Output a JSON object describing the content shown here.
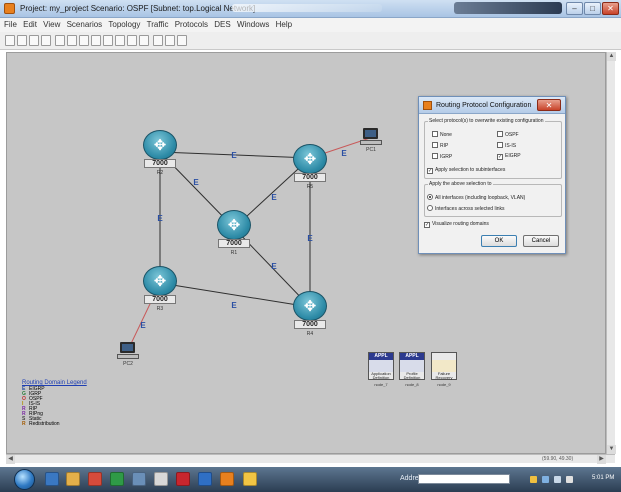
{
  "window": {
    "title": "Project: my_project Scenario: OSPF  [Subnet: top.Logical Network]",
    "min": "–",
    "max": "□",
    "close": "✕"
  },
  "menu": [
    "File",
    "Edit",
    "View",
    "Scenarios",
    "Topology",
    "Traffic",
    "Protocols",
    "DES",
    "Windows",
    "Help"
  ],
  "toolbar_icons": [
    "new-icon",
    "open-icon",
    "save-icon",
    "print-icon",
    "cut-icon",
    "object-palette-icon",
    "link-icon",
    "failure-icon",
    "zoom-in-icon",
    "zoom-out-icon",
    "configure-icon",
    "statistics-icon",
    "results-icon",
    "web-report-icon",
    "hide-icon"
  ],
  "network": {
    "link_label": "E",
    "router_model": "7000",
    "routers": [
      {
        "id": "R2",
        "name": "R2"
      },
      {
        "id": "R1",
        "name": "R1"
      },
      {
        "id": "R4_top",
        "name": "R5"
      },
      {
        "id": "R3",
        "name": "R3"
      },
      {
        "id": "R4",
        "name": "R4"
      }
    ],
    "pcs": [
      {
        "id": "PC1",
        "name": "PC1"
      },
      {
        "id": "PC2",
        "name": "PC2"
      }
    ],
    "nodes": [
      {
        "hdr": "APPL",
        "lbl1": "Application",
        "lbl2": "Definition",
        "name": "node_7"
      },
      {
        "hdr": "APPL",
        "lbl1": "Profile",
        "lbl2": "Definition",
        "name": "node_8"
      },
      {
        "hdr": "",
        "lbl1": "Failure",
        "lbl2": "Recovery",
        "name": "node_9"
      }
    ]
  },
  "legend": {
    "title": "Routing Domain Legend",
    "items": [
      {
        "k": "E",
        "v": "EIGRP",
        "color": "#2a4fa3"
      },
      {
        "k": "G",
        "v": "IGRP",
        "color": "#2a7d3a"
      },
      {
        "k": "O",
        "v": "OSPF",
        "color": "#c03030"
      },
      {
        "k": "I",
        "v": "IS-IS",
        "color": "#b08a00"
      },
      {
        "k": "R",
        "v": "RIP",
        "color": "#7a2aa3"
      },
      {
        "k": "R",
        "v": "RIPng",
        "color": "#7a2aa3"
      },
      {
        "k": "S",
        "v": "Static",
        "color": "#444444"
      },
      {
        "k": "R",
        "v": "Redistribution",
        "color": "#a35a00"
      }
    ]
  },
  "dialog": {
    "title": "Routing Protocol Configuration",
    "close": "✕",
    "group1_label": "Select protocol(s) to overwrite existing configuration",
    "protocols": [
      {
        "label": "None",
        "checked": false
      },
      {
        "label": "OSPF",
        "checked": false
      },
      {
        "label": "RIP",
        "checked": false
      },
      {
        "label": "IS-IS",
        "checked": false
      },
      {
        "label": "IGRP",
        "checked": false
      },
      {
        "label": "EIGRP",
        "checked": true
      }
    ],
    "apply_subinterfaces": "Apply selection to subinterfaces",
    "group2_label": "Apply the above selection to",
    "radio_all": "All interfaces (including loopback, VLAN)",
    "radio_links": "Interfaces across selected links",
    "visualize": "Visualize routing domains",
    "ok": "OK",
    "cancel": "Cancel"
  },
  "taskbar": {
    "address_label": "Address",
    "clock": "5:01 PM"
  },
  "status": {
    "coords": "(59.90, 49.30)"
  },
  "colors": {
    "workspace": "#c6c6c6",
    "link": "#2f2f2f",
    "pc_link": "#c85a5a",
    "eigrp_label": "#2a4fa3"
  }
}
